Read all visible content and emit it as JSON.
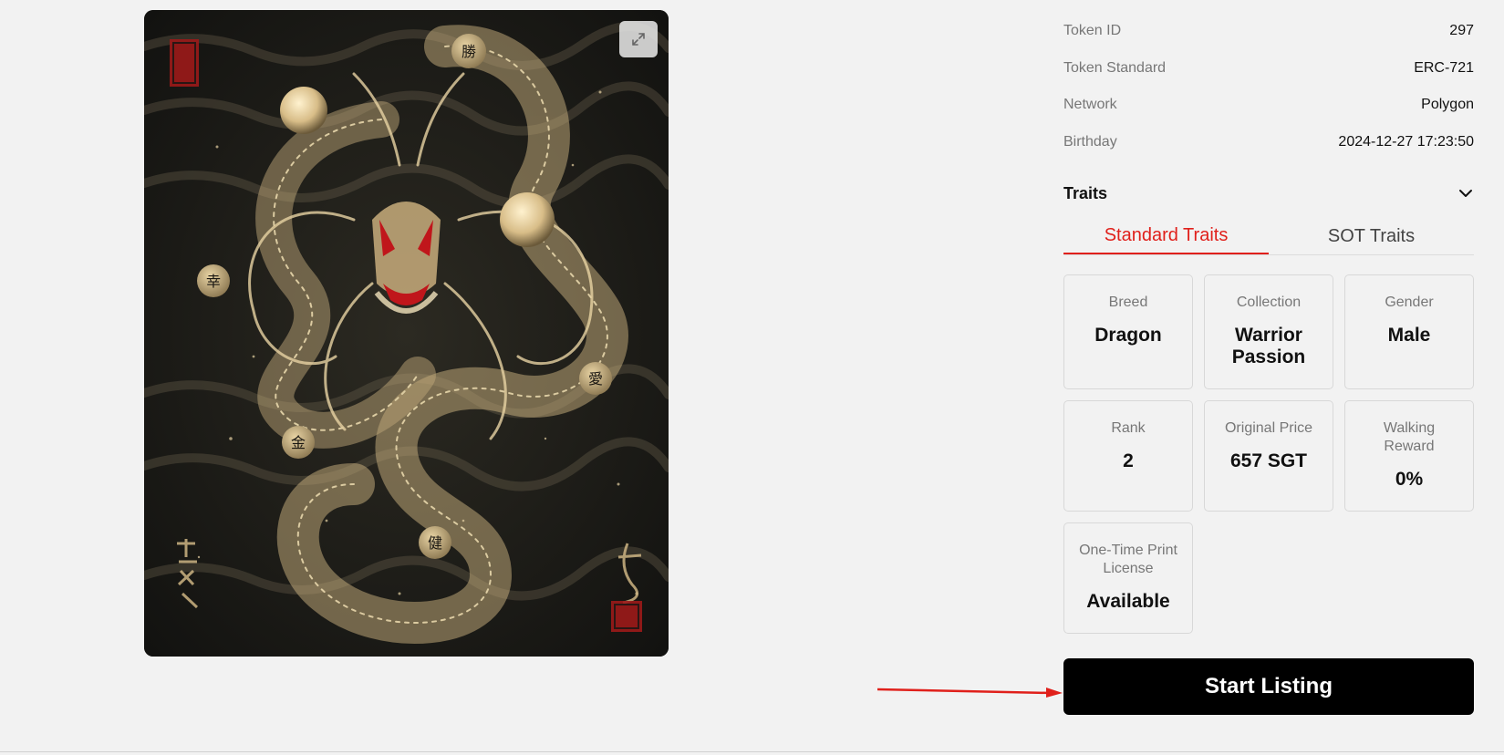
{
  "artwork": {
    "seal_chars": [
      "勝",
      "幸",
      "愛",
      "金",
      "健"
    ],
    "expand_icon": "expand-icon"
  },
  "info": [
    {
      "label": "Token ID",
      "value": "297"
    },
    {
      "label": "Token Standard",
      "value": "ERC-721"
    },
    {
      "label": "Network",
      "value": "Polygon"
    },
    {
      "label": "Birthday",
      "value": "2024-12-27 17:23:50"
    }
  ],
  "traits": {
    "title": "Traits",
    "toggle_icon": "chevron-down-icon",
    "tabs": [
      {
        "label": "Standard Traits",
        "active": true
      },
      {
        "label": "SOT Traits",
        "active": false
      }
    ],
    "cards": [
      {
        "label": "Breed",
        "value": "Dragon"
      },
      {
        "label": "Collection",
        "value": "Warrior Passion"
      },
      {
        "label": "Gender",
        "value": "Male"
      },
      {
        "label": "Rank",
        "value": "2"
      },
      {
        "label": "Original Price",
        "value": "657 SGT"
      },
      {
        "label": "Walking Reward",
        "value": "0%"
      },
      {
        "label": "One-Time Print License",
        "value": "Available"
      }
    ]
  },
  "actions": {
    "start_listing": "Start Listing"
  },
  "colors": {
    "accent": "#e0201b",
    "button_bg": "#000000",
    "page_bg": "#f2f2f2",
    "gold": "#d9c08f"
  }
}
